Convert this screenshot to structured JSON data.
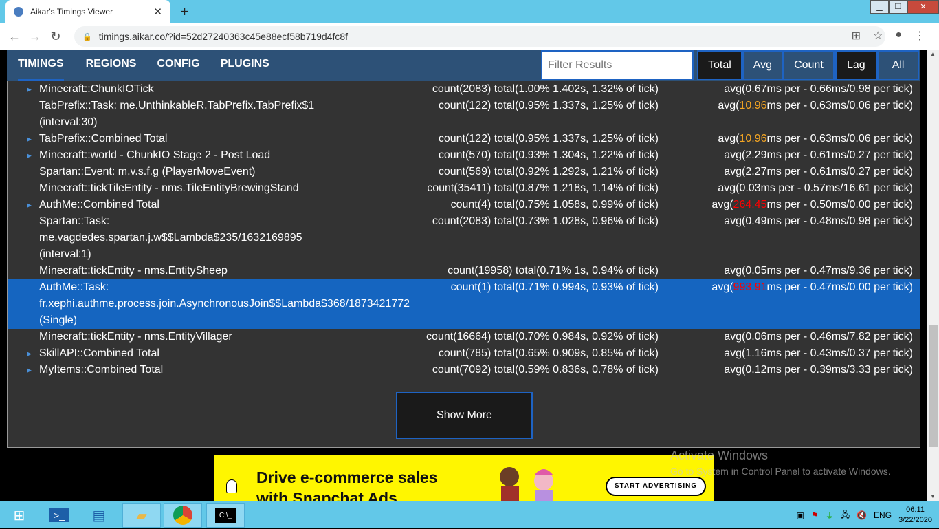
{
  "browser": {
    "tab_title": "Aikar's Timings Viewer",
    "url": "timings.aikar.co/?id=52d27240363c45e88ecf58b719d4fc8f"
  },
  "nav": {
    "links": [
      "TIMINGS",
      "REGIONS",
      "CONFIG",
      "PLUGINS"
    ],
    "filter_placeholder": "Filter Results",
    "modes": [
      "Total",
      "Avg",
      "Count"
    ],
    "views": [
      "Lag",
      "All"
    ]
  },
  "rows": [
    {
      "expand": true,
      "name": "Minecraft::ChunkIOTick",
      "stats": "count(2083)  total(1.00% 1.402s, 1.32% of tick)",
      "avg_pre": "avg(",
      "avg_val": "0.67",
      "avg_post": "ms per - 0.66ms/0.98 per tick)",
      "level": ""
    },
    {
      "expand": false,
      "name": "TabPrefix::Task: me.UnthinkableR.TabPrefix.TabPrefix$1 (interval:30)",
      "stats": "count(122)  total(0.95% 1.337s, 1.25% of tick)",
      "avg_pre": "avg(",
      "avg_val": "10.96",
      "avg_post": "ms per - 0.63ms/0.06 per tick)",
      "level": "orange"
    },
    {
      "expand": true,
      "name": "TabPrefix::Combined Total",
      "stats": "count(122)  total(0.95% 1.337s, 1.25% of tick)",
      "avg_pre": "avg(",
      "avg_val": "10.96",
      "avg_post": "ms per - 0.63ms/0.06 per tick)",
      "level": "orange"
    },
    {
      "expand": true,
      "name": "Minecraft::world - ChunkIO Stage 2 - Post Load",
      "stats": "count(570)  total(0.93% 1.304s, 1.22% of tick)",
      "avg_pre": "avg(",
      "avg_val": "2.29",
      "avg_post": "ms per - 0.61ms/0.27 per tick)",
      "level": ""
    },
    {
      "expand": false,
      "name": "Spartan::Event: m.v.s.f.g (PlayerMoveEvent)",
      "stats": "count(569)  total(0.92% 1.292s, 1.21% of tick)",
      "avg_pre": "avg(",
      "avg_val": "2.27",
      "avg_post": "ms per - 0.61ms/0.27 per tick)",
      "level": ""
    },
    {
      "expand": false,
      "name": "Minecraft::tickTileEntity - nms.TileEntityBrewingStand",
      "stats": "count(35411)  total(0.87% 1.218s, 1.14% of tick)",
      "avg_pre": "avg(",
      "avg_val": "0.03",
      "avg_post": "ms per - 0.57ms/16.61 per tick)",
      "level": ""
    },
    {
      "expand": true,
      "name": "AuthMe::Combined Total",
      "stats": "count(4)  total(0.75% 1.058s, 0.99% of tick)",
      "avg_pre": "avg(",
      "avg_val": "264.45",
      "avg_post": "ms per - 0.50ms/0.00 per tick)",
      "level": "red"
    },
    {
      "expand": false,
      "name": "Spartan::Task: me.vagdedes.spartan.j.w$$Lambda$235/1632169895 (interval:1)",
      "stats": "count(2083)  total(0.73% 1.028s, 0.96% of tick)",
      "avg_pre": "avg(",
      "avg_val": "0.49",
      "avg_post": "ms per - 0.48ms/0.98 per tick)",
      "level": ""
    },
    {
      "expand": false,
      "name": "Minecraft::tickEntity - nms.EntitySheep",
      "stats": "count(19958)  total(0.71% 1s, 0.94% of tick)",
      "avg_pre": "avg(",
      "avg_val": "0.05",
      "avg_post": "ms per - 0.47ms/9.36 per tick)",
      "level": ""
    },
    {
      "expand": false,
      "selected": true,
      "name": "AuthMe::Task: fr.xephi.authme.process.join.AsynchronousJoin$$Lambda$368/1873421772 (Single)",
      "stats": "count(1)  total(0.71% 0.994s, 0.93% of tick)",
      "avg_pre": "avg(",
      "avg_val": "993.91",
      "avg_post": "ms per - 0.47ms/0.00 per tick)",
      "level": "red"
    },
    {
      "expand": false,
      "name": "Minecraft::tickEntity - nms.EntityVillager",
      "stats": "count(16664)  total(0.70% 0.984s, 0.92% of tick)",
      "avg_pre": "avg(",
      "avg_val": "0.06",
      "avg_post": "ms per - 0.46ms/7.82 per tick)",
      "level": ""
    },
    {
      "expand": true,
      "name": "SkillAPI::Combined Total",
      "stats": "count(785)  total(0.65% 0.909s, 0.85% of tick)",
      "avg_pre": "avg(",
      "avg_val": "1.16",
      "avg_post": "ms per - 0.43ms/0.37 per tick)",
      "level": ""
    },
    {
      "expand": true,
      "name": "MyItems::Combined Total",
      "stats": "count(7092)  total(0.59% 0.836s, 0.78% of tick)",
      "avg_pre": "avg(",
      "avg_val": "0.12",
      "avg_post": "ms per - 0.39ms/3.33 per tick)",
      "level": ""
    }
  ],
  "show_more": "Show More",
  "ad": {
    "headline": "Drive e-commerce sales with Snapchat Ads.",
    "cta": "START ADVERTISING"
  },
  "watermark": {
    "title": "Activate Windows",
    "subtitle": "Go to System in Control Panel to activate Windows."
  },
  "taskbar": {
    "lang": "ENG",
    "time": "06:11",
    "date": "3/22/2020"
  }
}
